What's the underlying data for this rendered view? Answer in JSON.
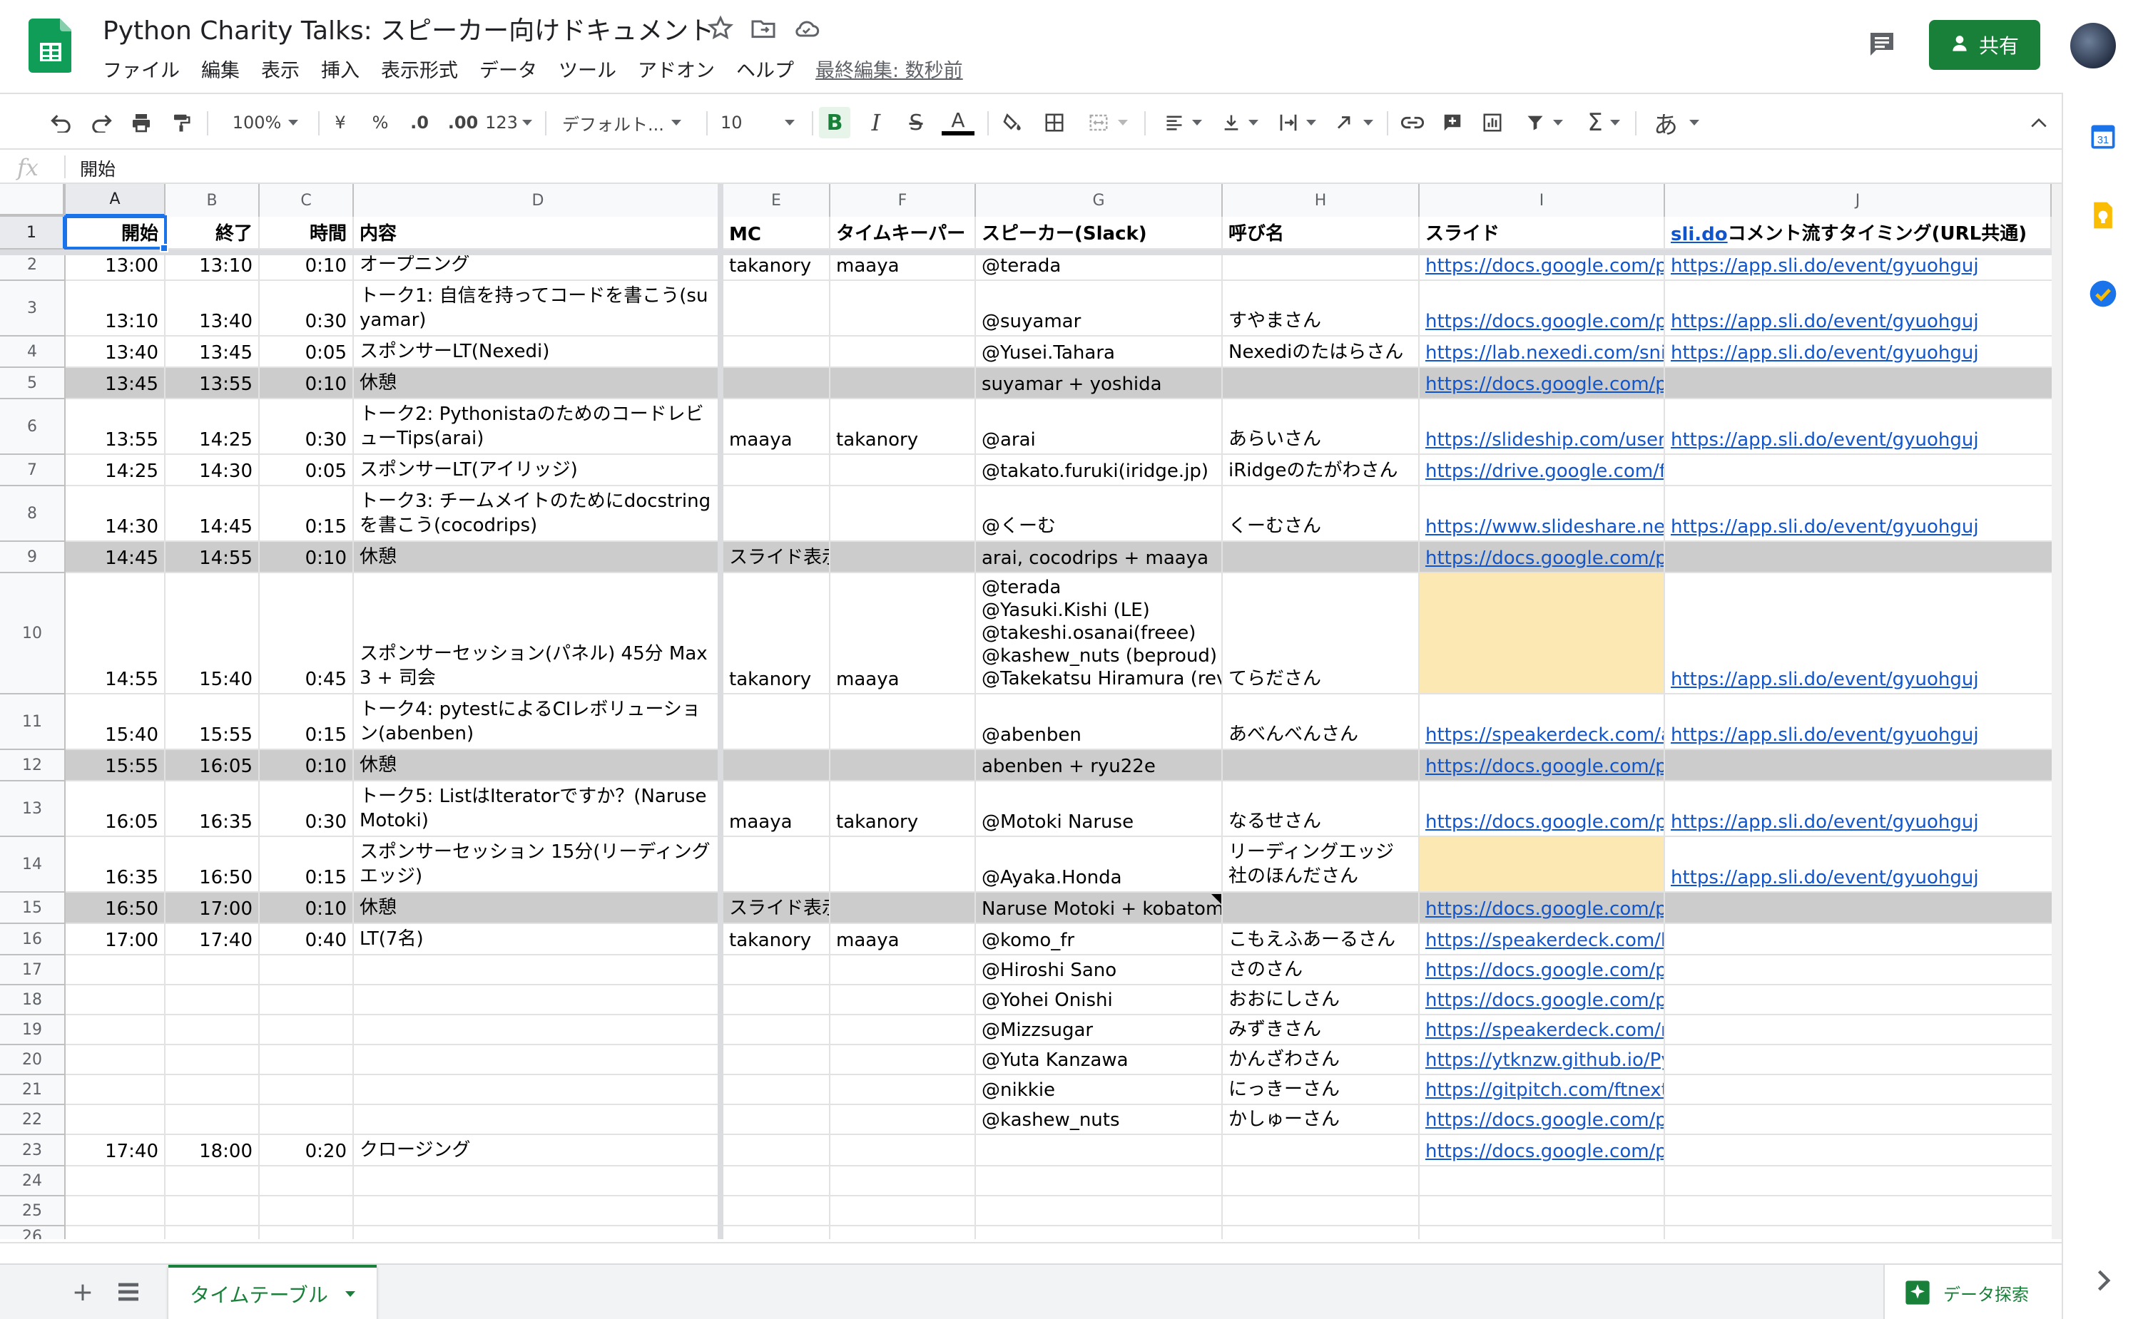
{
  "header": {
    "title": "Python Charity Talks: スピーカー向けドキュメント",
    "menu": [
      "ファイル",
      "編集",
      "表示",
      "挿入",
      "表示形式",
      "データ",
      "ツール",
      "アドオン",
      "ヘルプ"
    ],
    "last_edit": "最終編集: 数秒前",
    "share_label": "共有",
    "brand_color": "#188038"
  },
  "toolbar": {
    "zoom": "100%",
    "currency": "¥",
    "percent": "%",
    "decimal_decrease": ".0",
    "decimal_increase": ".00",
    "format_more": "123",
    "font": "デフォルト...",
    "font_size": "10",
    "input_tool": "あ"
  },
  "formula_bar": {
    "fx": "fx",
    "value": "開始"
  },
  "columns": [
    "A",
    "B",
    "C",
    "D",
    "E",
    "F",
    "G",
    "H",
    "I",
    "J"
  ],
  "rows": [
    {
      "n": "1",
      "type": "header",
      "cells": [
        "開始",
        "終了",
        "時間",
        "内容",
        "MC",
        "タイムキーパー",
        "スピーカー(Slack)",
        "呼び名",
        "スライド",
        ""
      ],
      "j_link": "sli.do",
      "j_rest": "コメント流すタイミング(URL共通)"
    },
    {
      "n": "2",
      "cells": [
        "13:00",
        "13:10",
        "0:10",
        "オープニング",
        "takanory",
        "maaya",
        "@terada",
        "",
        "https://docs.google.com/presentation",
        "https://app.sli.do/event/gyuohguj"
      ]
    },
    {
      "n": "3",
      "cells": [
        "13:10",
        "13:40",
        "0:30",
        "トーク1: 自信を持ってコードを書こう(suyamar)",
        "",
        "",
        "@suyamar",
        "すやまさん",
        "https://docs.google.com/presentation",
        "https://app.sli.do/event/gyuohguj"
      ]
    },
    {
      "n": "4",
      "cells": [
        "13:40",
        "13:45",
        "0:05",
        "スポンサーLT(Nexedi)",
        "",
        "",
        "@Yusei.Tahara",
        "Nexediのたはらさん",
        "https://lab.nexedi.com/snippets",
        "https://app.sli.do/event/gyuohguj"
      ]
    },
    {
      "n": "5",
      "type": "gray",
      "cells": [
        "13:45",
        "13:55",
        "0:10",
        "休憩",
        "",
        "",
        "suyamar + yoshida",
        "",
        "https://docs.google.com/presentation",
        ""
      ]
    },
    {
      "n": "6",
      "cells": [
        "13:55",
        "14:25",
        "0:30",
        "トーク2: PythonistaのためのコードレビューTips(arai)",
        "maaya",
        "takanory",
        "@arai",
        "あらいさん",
        "https://slideship.com/users/@arai",
        "https://app.sli.do/event/gyuohguj"
      ]
    },
    {
      "n": "7",
      "cells": [
        "14:25",
        "14:30",
        "0:05",
        "スポンサーLT(アイリッジ)",
        "",
        "",
        "@takato.furuki(iridge.jp)",
        "iRidgeのたがわさん",
        "https://drive.google.com/file/d",
        ""
      ]
    },
    {
      "n": "8",
      "cells": [
        "14:30",
        "14:45",
        "0:15",
        "トーク3: チームメイトのためにdocstringを書こう(cocodrips)",
        "",
        "",
        "@くーむ",
        "くーむさん",
        "https://www.slideshare.net/cocodrips",
        "https://app.sli.do/event/gyuohguj"
      ]
    },
    {
      "n": "9",
      "type": "gray",
      "cells": [
        "14:45",
        "14:55",
        "0:10",
        "休憩",
        "スライド表示する",
        "",
        "arai, cocodrips + maaya",
        "",
        "https://docs.google.com/presentation",
        ""
      ]
    },
    {
      "n": "10",
      "cells": [
        "14:55",
        "15:40",
        "0:45",
        "スポンサーセッション(パネル) 45分 Max 3 + 司会",
        "takanory",
        "maaya",
        "@terada\n@Yasuki.Kishi (LE)\n@takeshi.osanai(freee)\n@kashew_nuts (beproud)\n@Takekatsu Hiramura (revcomm)",
        "てらださん",
        "",
        "https://app.sli.do/event/gyuohguj"
      ],
      "yellow_i": true
    },
    {
      "n": "11",
      "cells": [
        "15:40",
        "15:55",
        "0:15",
        "トーク4: pytestによるCIレボリューション(abenben)",
        "",
        "",
        "@abenben",
        "あべんべんさん",
        "https://speakerdeck.com/abenben",
        "https://app.sli.do/event/gyuohguj"
      ]
    },
    {
      "n": "12",
      "type": "gray",
      "cells": [
        "15:55",
        "16:05",
        "0:10",
        "休憩",
        "",
        "",
        "abenben + ryu22e",
        "",
        "https://docs.google.com/presentation",
        ""
      ]
    },
    {
      "n": "13",
      "cells": [
        "16:05",
        "16:35",
        "0:30",
        "トーク5: ListはIteratorですか？(Naruse Motoki)",
        "maaya",
        "takanory",
        "@Motoki Naruse",
        "なるせさん",
        "https://docs.google.com/presentation",
        "https://app.sli.do/event/gyuohguj"
      ]
    },
    {
      "n": "14",
      "cells": [
        "16:35",
        "16:50",
        "0:15",
        "スポンサーセッション 15分(リーディングエッジ)",
        "",
        "",
        "@Ayaka.Honda",
        "リーディングエッジ社のほんださん",
        "",
        "https://app.sli.do/event/gyuohguj"
      ],
      "yellow_i": true
    },
    {
      "n": "15",
      "type": "gray",
      "cells": [
        "16:50",
        "17:00",
        "0:10",
        "休憩",
        "スライド表示する",
        "",
        "Naruse Motoki + kobatomo",
        "",
        "https://docs.google.com/presentation",
        ""
      ],
      "note_g": true
    },
    {
      "n": "16",
      "cells": [
        "17:00",
        "17:40",
        "0:40",
        "LT(7名)",
        "takanory",
        "maaya",
        "@komo_fr",
        "こもえふあーるさん",
        "https://speakerdeck.com/komo_fr",
        ""
      ]
    },
    {
      "n": "17",
      "cells": [
        "",
        "",
        "",
        "",
        "",
        "",
        "@Hiroshi Sano",
        "さのさん",
        "https://docs.google.com/presentation",
        ""
      ]
    },
    {
      "n": "18",
      "cells": [
        "",
        "",
        "",
        "",
        "",
        "",
        "@Yohei Onishi",
        "おおにしさん",
        "https://docs.google.com/presentation",
        ""
      ]
    },
    {
      "n": "19",
      "cells": [
        "",
        "",
        "",
        "",
        "",
        "",
        "@Mizzsugar",
        "みずきさん",
        "https://speakerdeck.com/mizzsugar",
        ""
      ]
    },
    {
      "n": "20",
      "cells": [
        "",
        "",
        "",
        "",
        "",
        "",
        "@Yuta Kanzawa",
        "かんざわさん",
        "https://ytknzw.github.io/PyCon",
        ""
      ]
    },
    {
      "n": "21",
      "cells": [
        "",
        "",
        "",
        "",
        "",
        "",
        "@nikkie",
        "にっきーさん",
        "https://gitpitch.com/ftnext/2020",
        ""
      ]
    },
    {
      "n": "22",
      "cells": [
        "",
        "",
        "",
        "",
        "",
        "",
        "@kashew_nuts",
        "かしゅーさん",
        "https://docs.google.com/presentation",
        ""
      ]
    },
    {
      "n": "23",
      "cells": [
        "17:40",
        "18:00",
        "0:20",
        "クロージング",
        "",
        "",
        "",
        "",
        "https://docs.google.com/presentation",
        ""
      ]
    },
    {
      "n": "24",
      "cells": [
        "",
        "",
        "",
        "",
        "",
        "",
        "",
        "",
        "",
        ""
      ]
    },
    {
      "n": "25",
      "cells": [
        "",
        "",
        "",
        "",
        "",
        "",
        "",
        "",
        "",
        ""
      ]
    },
    {
      "n": "26",
      "cells": [
        "",
        "",
        "",
        "",
        "",
        "",
        "",
        "",
        "",
        ""
      ]
    }
  ],
  "sheet_tab": "タイムテーブル",
  "explore_label": "データ探索",
  "sidebar": {
    "calendar_day": "31"
  },
  "colors": {
    "selection": "#1a73e8",
    "link": "#1155cc",
    "gray_row": "#cccccc",
    "highlight": "#fce8b2"
  }
}
